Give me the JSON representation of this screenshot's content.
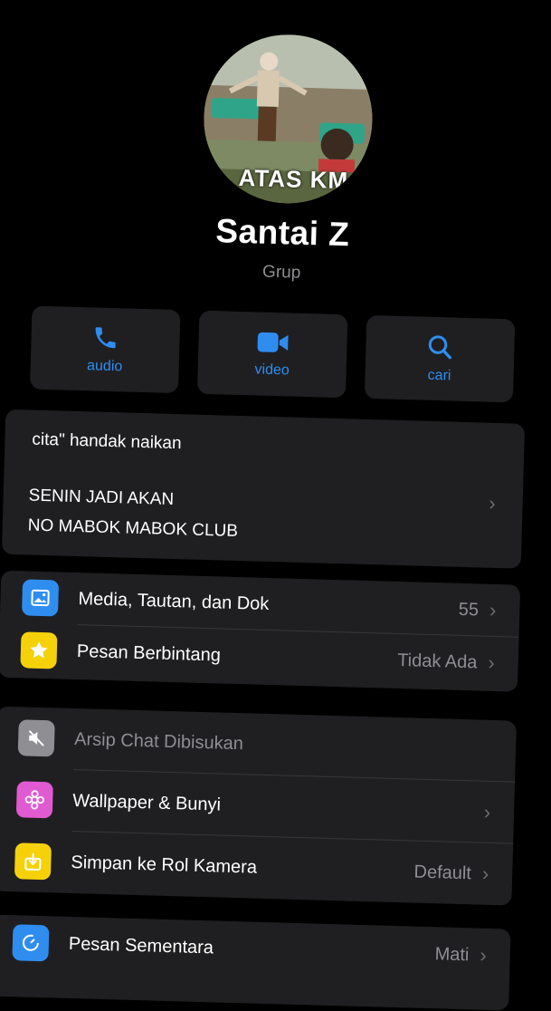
{
  "profile": {
    "name": "Santai Z",
    "type": "Grup",
    "photo_caption": "ATAS KM"
  },
  "actions": [
    {
      "label": "audio",
      "icon": "phone-icon"
    },
    {
      "label": "video",
      "icon": "video-camera-icon"
    },
    {
      "label": "cari",
      "icon": "search-icon"
    }
  ],
  "description": {
    "line1": "cita\" handak naikan",
    "line2": "SENIN JADI AKAN",
    "line3": "NO MABOK MABOK CLUB"
  },
  "group1": [
    {
      "label": "Media, Tautan, dan Dok",
      "value": "55",
      "icon": "photo-icon",
      "color": "#2f8df0"
    },
    {
      "label": "Pesan Berbintang",
      "value": "Tidak Ada",
      "icon": "star-icon",
      "color": "#f5d10a"
    }
  ],
  "group2": [
    {
      "label": "Arsip Chat Dibisukan",
      "value": "",
      "icon": "mute-icon",
      "color": "#8e8e93"
    },
    {
      "label": "Wallpaper & Bunyi",
      "value": "",
      "icon": "flower-icon",
      "color": "#e05ad2"
    },
    {
      "label": "Simpan ke Rol Kamera",
      "value": "Default",
      "icon": "download-icon",
      "color": "#f5d10a"
    }
  ],
  "group3": [
    {
      "label": "Pesan Sementara",
      "value": "Mati",
      "icon": "timer-icon",
      "color": "#2f8df0"
    }
  ],
  "colors": {
    "accent": "#2f8df0",
    "card": "#1f1f21",
    "secondary_text": "#8e8e93"
  }
}
